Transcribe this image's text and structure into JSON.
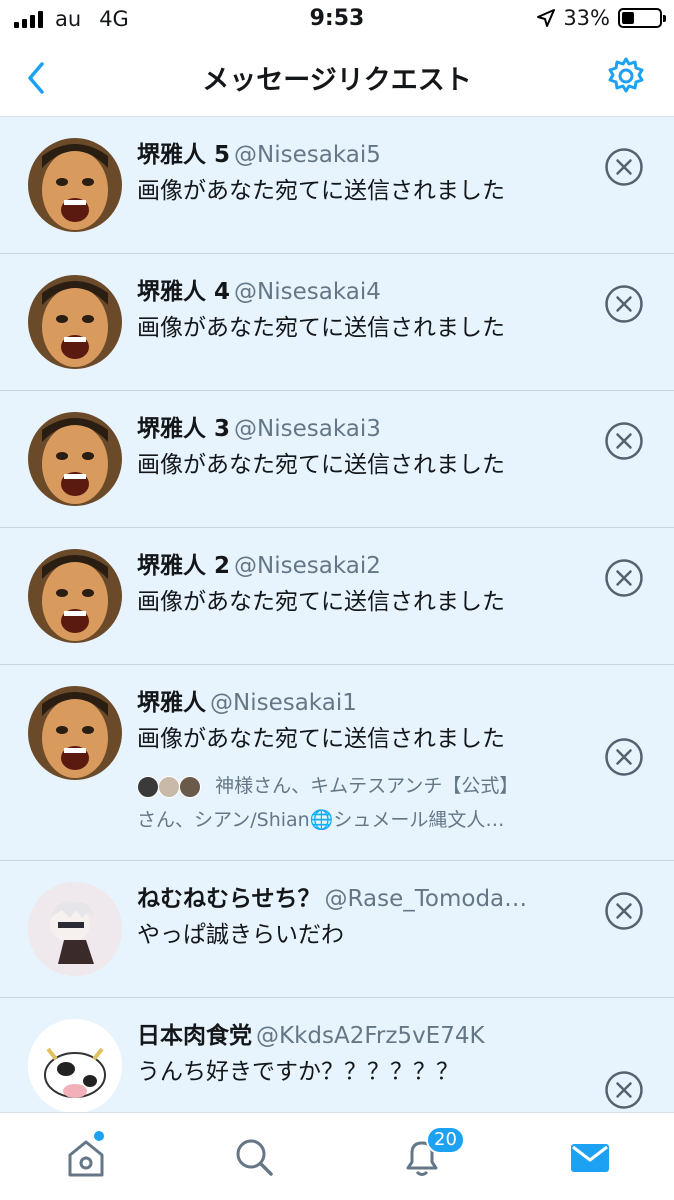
{
  "status": {
    "carrier": "au",
    "network": "4G",
    "time": "9:53",
    "battery": "33%",
    "battery_level": 0.33
  },
  "header": {
    "title": "メッセージリクエスト",
    "back_icon": "chevron-left-icon",
    "settings_icon": "gear-icon"
  },
  "requests": [
    {
      "name": "堺雅人 5",
      "handle": "@Nisesakai5",
      "text": "画像があなた宛てに送信されました"
    },
    {
      "name": "堺雅人 4",
      "handle": "@Nisesakai4",
      "text": "画像があなた宛てに送信されました"
    },
    {
      "name": "堺雅人 3",
      "handle": "@Nisesakai3",
      "text": "画像があなた宛てに送信されました"
    },
    {
      "name": "堺雅人 2",
      "handle": "@Nisesakai2",
      "text": "画像があなた宛てに送信されました"
    },
    {
      "name": "堺雅人",
      "handle": "@Nisesakai1",
      "text": "画像があなた宛てに送信されました",
      "followers_line1": "神様さん、キムテスアンチ【公式】",
      "followers_line2": "さん、シアン/Shian🌐シュメール縄文人…"
    },
    {
      "name": "ねむねむらせち？",
      "handle": "@Rase_Tomoda…",
      "text": "やっぱ誠きらいだわ"
    },
    {
      "name": "日本肉食党",
      "handle": "@KkdsA2Frz5vE74K",
      "text": "うんち好きですか？？？？？？"
    }
  ],
  "tabs": {
    "notifications_badge": "20"
  },
  "colors": {
    "accent": "#1da1f2",
    "row_bg": "#e8f4fd"
  }
}
